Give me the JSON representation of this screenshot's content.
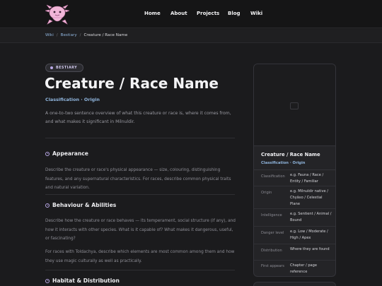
{
  "nav": {
    "logo_icon": "axolotl-logo-icon",
    "links": [
      "Home",
      "About",
      "Projects",
      "Blog",
      "Wiki"
    ]
  },
  "breadcrumb": {
    "items": [
      "Wiki",
      "Bestiary"
    ],
    "current": "Creature / Race Name",
    "separator": "/"
  },
  "page": {
    "badge": "BESTIARY",
    "title": "Creature / Race Name",
    "classification": "Classification · Origin",
    "intro": "A one-to-two sentence overview of what this creature or race is, where it comes from, and what makes it significant in Milnuldir."
  },
  "sections": [
    {
      "heading": "Appearance",
      "paragraphs": [
        "Describe the creature or race's physical appearance — size, colouring, distinguishing features, and any supernatural characteristics. For races, describe common physical traits and natural variation."
      ]
    },
    {
      "heading": "Behaviour & Abilities",
      "paragraphs": [
        "Describe how the creature or race behaves — its temperament, social structure (if any), and how it interacts with other species. What is it capable of? What makes it dangerous, useful, or fascinating?",
        "For races with Toldachya, describe which elements are most common among them and how they use magic culturally as well as practically."
      ]
    },
    {
      "heading": "Habitat & Distribution",
      "paragraphs": []
    }
  ],
  "infobox": {
    "title": "Creature / Race Name",
    "classification": "Classification · Origin",
    "image_icon": "image-placeholder-icon",
    "rows": [
      {
        "key": "Classification",
        "value": "e.g. Fauna / Race / Entity / Familiar"
      },
      {
        "key": "Origin",
        "value": "e.g. Milnuldir native / Chyāso / Celestial Plane"
      },
      {
        "key": "Intelligence",
        "value": "e.g. Sentient / Animal / Bound"
      },
      {
        "key": "Danger level",
        "value": "e.g. Low / Moderate / High / Apex"
      },
      {
        "key": "Distribution",
        "value": "Where they are found"
      },
      {
        "key": "First appears",
        "value": "Chapter / page reference"
      }
    ]
  },
  "colors": {
    "accent_link": "#8fb4dc",
    "badge_accent": "#b9a8e6",
    "background": "#1b1b1d"
  }
}
